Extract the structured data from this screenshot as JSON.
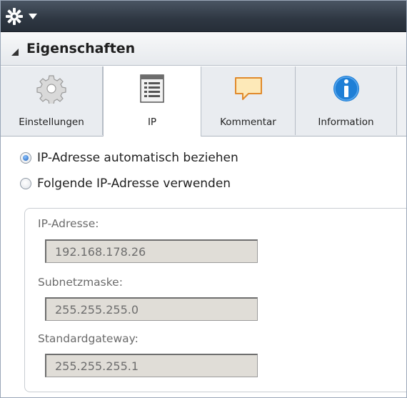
{
  "toolbar": {
    "menu_icon": "gear-icon",
    "dropdown_icon": "caret-down-icon"
  },
  "section": {
    "title": "Eigenschaften",
    "collapse_icon": "triangle-down-icon"
  },
  "tabs": [
    {
      "label": "Einstellungen",
      "icon": "gear-icon",
      "active": false
    },
    {
      "label": "IP",
      "icon": "list-document-icon",
      "active": true
    },
    {
      "label": "Kommentar",
      "icon": "speech-bubble-icon",
      "active": false
    },
    {
      "label": "Information",
      "icon": "info-icon",
      "active": false
    }
  ],
  "ip_mode": {
    "options": [
      {
        "label": "IP-Adresse automatisch beziehen",
        "checked": true
      },
      {
        "label": "Folgende IP-Adresse verwenden",
        "checked": false
      }
    ]
  },
  "fields": [
    {
      "label": "IP-Adresse:",
      "value": "192.168.178.26"
    },
    {
      "label": "Subnetzmaske:",
      "value": "255.255.255.0"
    },
    {
      "label": "Standardgateway:",
      "value": "255.255.255.1"
    }
  ],
  "colors": {
    "toolbar": "#2e3742",
    "info_blue": "#1f7fd6",
    "field_bg": "#e0ddd7",
    "comment_fill": "#fde9b8",
    "comment_stroke": "#e08a2b"
  }
}
